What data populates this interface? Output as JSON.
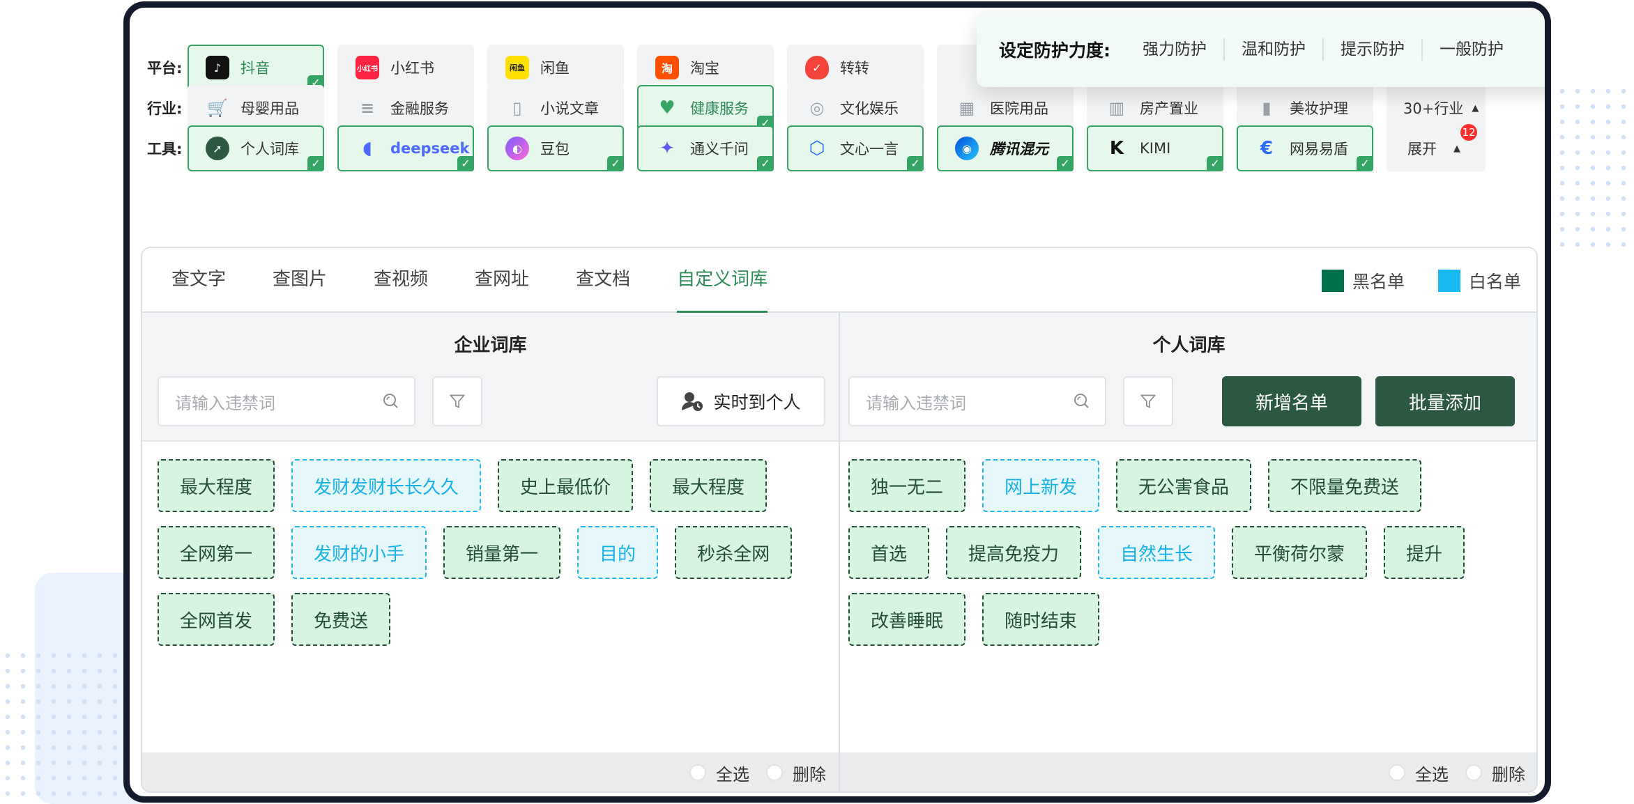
{
  "colors": {
    "accent_green": "#2e8b57",
    "dark_green": "#2b5840",
    "blacklist": "#00704a",
    "whitelist": "#17b9f1",
    "badge_red": "#ff2e2e"
  },
  "filters": {
    "platform": {
      "label": "平台:",
      "chips": [
        {
          "label": "抖音",
          "icon": "douyin-icon",
          "active": true
        },
        {
          "label": "小红书",
          "icon": "xiaohongshu-icon",
          "active": false
        },
        {
          "label": "闲鱼",
          "icon": "xianyu-icon",
          "active": false
        },
        {
          "label": "淘宝",
          "icon": "taobao-icon",
          "active": false
        },
        {
          "label": "转转",
          "icon": "zhuanzhuan-icon",
          "active": false
        }
      ]
    },
    "industry": {
      "label": "行业:",
      "chips": [
        {
          "label": "母婴用品",
          "icon": "stroller-icon",
          "active": false
        },
        {
          "label": "金融服务",
          "icon": "coins-icon",
          "active": false
        },
        {
          "label": "小说文章",
          "icon": "book-icon",
          "active": false
        },
        {
          "label": "健康服务",
          "icon": "heart-icon",
          "active": true
        },
        {
          "label": "文化娱乐",
          "icon": "disc-icon",
          "active": false
        },
        {
          "label": "医院用品",
          "icon": "hospital-icon",
          "active": false
        },
        {
          "label": "房产置业",
          "icon": "building-icon",
          "active": false
        },
        {
          "label": "美妆护理",
          "icon": "cosmetics-icon",
          "active": false
        }
      ],
      "more": "30+行业"
    },
    "tools": {
      "label": "工具:",
      "chips": [
        {
          "label": "个人词库",
          "icon": "personal-lexicon-icon",
          "active": true
        },
        {
          "label": "deepseek",
          "icon": "deepseek-icon",
          "active": true
        },
        {
          "label": "豆包",
          "icon": "doubao-icon",
          "active": true
        },
        {
          "label": "通义千问",
          "icon": "tongyi-icon",
          "active": true
        },
        {
          "label": "文心一言",
          "icon": "wenxin-icon",
          "active": true
        },
        {
          "label": "腾讯混元",
          "icon": "hunyuan-icon",
          "active": true
        },
        {
          "label": "KIMI",
          "icon": "kimi-icon",
          "active": true
        },
        {
          "label": "网易易盾",
          "icon": "yidun-icon",
          "active": true
        }
      ],
      "more": "展开",
      "badge": "12"
    }
  },
  "protection": {
    "title": "设定防护力度:",
    "options": [
      "强力防护",
      "温和防护",
      "提示防护",
      "一般防护"
    ]
  },
  "tabs": [
    "查文字",
    "查图片",
    "查视频",
    "查网址",
    "查文档",
    "自定义词库"
  ],
  "active_tab": "自定义词库",
  "legend": {
    "black": "黑名单",
    "white": "白名单"
  },
  "enterprise": {
    "title": "企业词库",
    "search_placeholder": "请输入违禁词",
    "realtime_label": "实时到个人",
    "rows": [
      [
        {
          "text": "最大程度",
          "type": "black"
        },
        {
          "text": "发财发财长长久久",
          "type": "white"
        },
        {
          "text": "史上最低价",
          "type": "black"
        },
        {
          "text": "最大程度",
          "type": "black"
        }
      ],
      [
        {
          "text": "全网第一",
          "type": "black"
        },
        {
          "text": "发财的小手",
          "type": "white"
        },
        {
          "text": "销量第一",
          "type": "black"
        },
        {
          "text": "目的",
          "type": "white"
        },
        {
          "text": "秒杀全网",
          "type": "black"
        }
      ],
      [
        {
          "text": "全网首发",
          "type": "black"
        },
        {
          "text": "免费送",
          "type": "black"
        }
      ]
    ],
    "select_all": "全选",
    "delete": "删除"
  },
  "personal": {
    "title": "个人词库",
    "search_placeholder": "请输入违禁词",
    "add_list_label": "新增名单",
    "batch_add_label": "批量添加",
    "rows": [
      [
        {
          "text": "独一无二",
          "type": "black"
        },
        {
          "text": "网上新发",
          "type": "white"
        },
        {
          "text": "无公害食品",
          "type": "black"
        },
        {
          "text": "不限量免费送",
          "type": "black"
        }
      ],
      [
        {
          "text": "首选",
          "type": "black"
        },
        {
          "text": "提高免疫力",
          "type": "black"
        },
        {
          "text": "自然生长",
          "type": "white"
        },
        {
          "text": "平衡荷尔蒙",
          "type": "black"
        },
        {
          "text": "提升",
          "type": "black"
        }
      ],
      [
        {
          "text": "改善睡眠",
          "type": "black"
        },
        {
          "text": "随时结束",
          "type": "black"
        }
      ]
    ],
    "select_all": "全选",
    "delete": "删除"
  }
}
